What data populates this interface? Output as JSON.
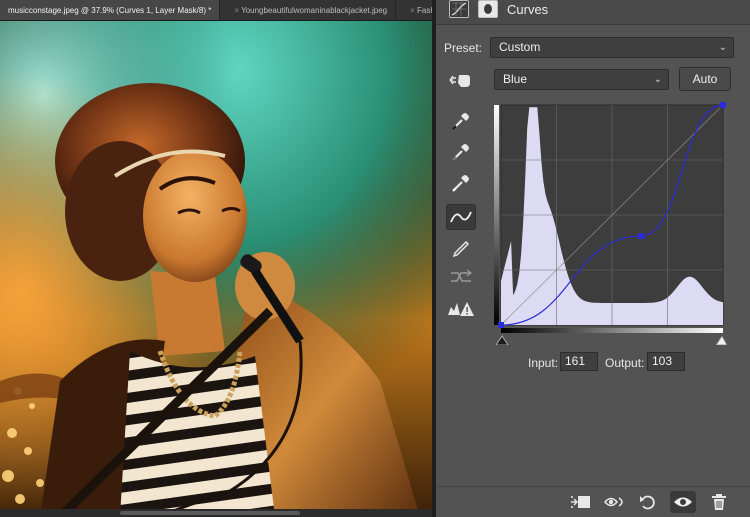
{
  "document": {
    "tabs": [
      {
        "label": "musicconstage.jpeg @ 37.9% (Curves 1, Layer Mask/8) *",
        "active": true
      },
      {
        "label": "Youngbeautifulwomaninablackjacket.jpeg",
        "active": false
      },
      {
        "label": "Fashionshotofayounghiphopdancer.jpeg",
        "active": false
      }
    ],
    "close_glyph": "×"
  },
  "properties": {
    "title": "Curves",
    "preset_label": "Preset:",
    "preset_value": "Custom",
    "channel_value": "Blue",
    "auto_label": "Auto",
    "input_label": "Input:",
    "input_value": "161",
    "output_label": "Output:",
    "output_value": "103"
  },
  "icons": {
    "tools": [
      "targeted-adjust-icon",
      "black-point-eyedropper-icon",
      "gray-point-eyedropper-icon",
      "white-point-eyedropper-icon",
      "curve-point-icon",
      "pencil-icon",
      "smooth-icon",
      "clipping-warning-icon"
    ],
    "footer": [
      "clip-to-layer-icon",
      "view-previous-icon",
      "reset-icon",
      "visibility-eye-icon",
      "trash-icon"
    ]
  },
  "curve": {
    "channel_color": "#2b2bd8",
    "points": [
      [
        0,
        0
      ],
      [
        161,
        103
      ],
      [
        255,
        255
      ]
    ],
    "histogram_color": "#dcdbf3"
  },
  "colors": {
    "panel_bg": "#535353",
    "field_bg": "#3f3f3f"
  }
}
